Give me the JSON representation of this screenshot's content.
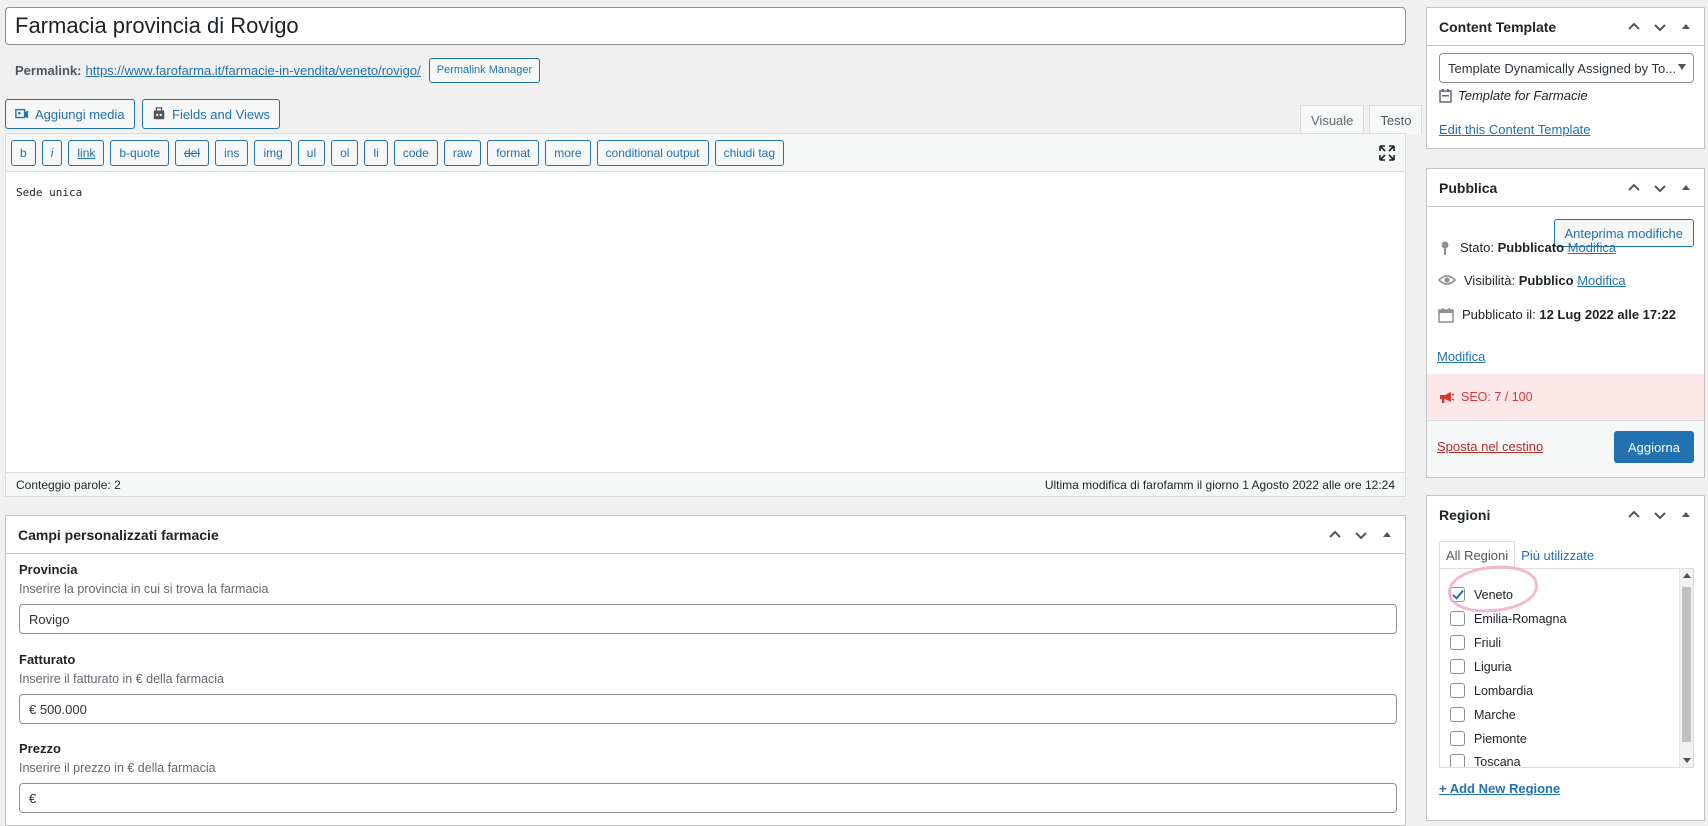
{
  "title": {
    "value": "Farmacia  provincia di Rovigo"
  },
  "permalink": {
    "label": "Permalink:",
    "url": "https://www.farofarma.it/farmacie-in-vendita/veneto/rovigo/",
    "manager_button": "Permalink Manager"
  },
  "media_buttons": {
    "add_media": "Aggiungi media",
    "fields_views": "Fields and Views"
  },
  "editor": {
    "tabs": [
      "Visuale",
      "Testo"
    ],
    "active_tab": "Testo",
    "quicktags": [
      "b",
      "i",
      "link",
      "b-quote",
      "del",
      "ins",
      "img",
      "ul",
      "ol",
      "li",
      "code",
      "raw",
      "format",
      "more",
      "conditional output",
      "chiudi tag"
    ],
    "content": "Sede unica",
    "word_count": "Conteggio parole: 2",
    "last_edit": "Ultima modifica di farofamm il giorno 1 Agosto 2022 alle ore 12:24"
  },
  "custom_fields": {
    "title": "Campi personalizzati farmacie",
    "fields": [
      {
        "label": "Provincia",
        "description": "Inserire la provincia in cui si trova la farmacia",
        "value": "Rovigo"
      },
      {
        "label": "Fatturato",
        "description": "Inserire il fatturato in € della farmacia",
        "value": "€ 500.000"
      },
      {
        "label": "Prezzo",
        "description": "Inserire il prezzo in € della farmacia",
        "value": "€"
      }
    ]
  },
  "content_template": {
    "title": "Content Template",
    "select_value": "Template Dynamically Assigned by To...",
    "template_name": "Template for Farmacie",
    "edit_link": "Edit this Content Template"
  },
  "publish": {
    "title": "Pubblica",
    "preview_button": "Anteprima modifiche",
    "status_label": "Stato:",
    "status_value": "Pubblicato",
    "visibility_label": "Visibilità:",
    "visibility_value": "Pubblico",
    "published_label": "Pubblicato il:",
    "published_value": "12 Lug 2022 alle 17:22",
    "edit_link": "Modifica",
    "seo": "SEO: 7 / 100",
    "trash_link": "Sposta nel cestino",
    "update_button": "Aggiorna"
  },
  "regions": {
    "title": "Regioni",
    "tabs": [
      "All Regioni",
      "Più utilizzate"
    ],
    "items": [
      {
        "label": "Veneto",
        "checked": true
      },
      {
        "label": "Emilia-Romagna",
        "checked": false
      },
      {
        "label": "Friuli",
        "checked": false
      },
      {
        "label": "Liguria",
        "checked": false
      },
      {
        "label": "Lombardia",
        "checked": false
      },
      {
        "label": "Marche",
        "checked": false
      },
      {
        "label": "Piemonte",
        "checked": false
      },
      {
        "label": "Toscana",
        "checked": false
      }
    ],
    "add_new": "+ Add New Regione"
  },
  "colors": {
    "accent": "#2271b1",
    "danger": "#d63638",
    "seo_bg": "#fce8e8",
    "highlight": "#f3aacb"
  }
}
